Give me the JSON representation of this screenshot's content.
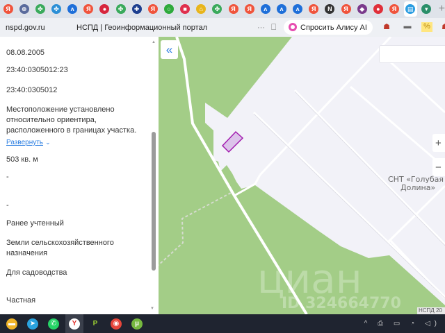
{
  "browser": {
    "tabs": [
      {
        "icon": "yandex-icon",
        "color": "#f0543c",
        "glyph": "Я"
      },
      {
        "icon": "emblem-icon",
        "color": "#5a6b9c",
        "glyph": "⊕"
      },
      {
        "icon": "gosuslugi-icon",
        "color": "#3aaa5c",
        "glyph": "✤"
      },
      {
        "icon": "gosuslugi-icon",
        "color": "#2b8fd6",
        "glyph": "✤"
      },
      {
        "icon": "avito-icon",
        "color": "#1e6fd9",
        "glyph": "ʌ"
      },
      {
        "icon": "yandex-icon",
        "color": "#f0543c",
        "glyph": "Я"
      },
      {
        "icon": "flag-icon",
        "color": "#d7263d",
        "glyph": "●"
      },
      {
        "icon": "gosuslugi-icon",
        "color": "#3aaa5c",
        "glyph": "✤"
      },
      {
        "icon": "hospital-icon",
        "color": "#1d3f8f",
        "glyph": "✚"
      },
      {
        "icon": "yandex-icon",
        "color": "#f0543c",
        "glyph": "Я"
      },
      {
        "icon": "circle-icon",
        "color": "#2eaa3c",
        "glyph": "○"
      },
      {
        "icon": "chat-icon",
        "color": "#e0304e",
        "glyph": "■"
      },
      {
        "icon": "home-icon",
        "color": "#e8b51c",
        "glyph": "⌂"
      },
      {
        "icon": "gosuslugi-icon",
        "color": "#3aaa5c",
        "glyph": "✤"
      },
      {
        "icon": "yandex-icon",
        "color": "#f0543c",
        "glyph": "Я"
      },
      {
        "icon": "yandex-icon",
        "color": "#f0543c",
        "glyph": "Я"
      },
      {
        "icon": "avito-icon",
        "color": "#1e6fd9",
        "glyph": "ʌ"
      },
      {
        "icon": "avito-icon",
        "color": "#1e6fd9",
        "glyph": "ʌ"
      },
      {
        "icon": "avito-icon",
        "color": "#1e6fd9",
        "glyph": "ʌ"
      },
      {
        "icon": "yandex-icon",
        "color": "#f0543c",
        "glyph": "Я"
      },
      {
        "icon": "notion-icon",
        "color": "#333333",
        "glyph": "N"
      },
      {
        "icon": "yandex-icon",
        "color": "#f0543c",
        "glyph": "Я"
      },
      {
        "icon": "shield-icon",
        "color": "#7a3a8c",
        "glyph": "◆"
      },
      {
        "icon": "map-pin-icon",
        "color": "#e0303a",
        "glyph": "●"
      },
      {
        "icon": "yandex-icon",
        "color": "#f0543c",
        "glyph": "Я"
      },
      {
        "icon": "nspd-icon",
        "color": "#2a9de1",
        "glyph": "▤",
        "active": true
      },
      {
        "icon": "map-icon",
        "color": "#2a8f6a",
        "glyph": "▾"
      }
    ],
    "url": "nspd.gov.ru",
    "page_title": "НСПД | Геоинформационный портал",
    "more_glyph": "···",
    "alice_label": "Спросить Алису AI",
    "ext_percent": "%"
  },
  "panel": {
    "fields": [
      "08.08.2005",
      "23:40:0305012:23",
      "23:40:0305012",
      "Местоположение установлено относительно ориентира, расположенного в границах участка.",
      "503 кв. м",
      "-",
      "-",
      "Ранее учтенный",
      "Земли сельскохозяйственного назначения",
      "Для садоводства",
      "Частная"
    ],
    "expand_label": "Развернуть"
  },
  "map": {
    "collapse_glyph": "«",
    "zoom_in": "+",
    "zoom_out": "−",
    "label_line1": "СНТ «Голубая",
    "label_line2": "Долина»",
    "watermark": "циан",
    "watermark_id": "ID 324664770",
    "attribution": "НСПД 20",
    "colors": {
      "forest": "#a3cd87",
      "land": "#f2f2f8",
      "parcel": "#a21caf",
      "road": "#ffffff"
    }
  },
  "taskbar": {
    "apps": [
      {
        "icon": "file-explorer-icon",
        "color": "#f0b429",
        "glyph": "▬"
      },
      {
        "icon": "telegram-icon",
        "color": "#2aa3de",
        "glyph": "➤"
      },
      {
        "icon": "whatsapp-icon",
        "color": "#25d366",
        "glyph": "✆"
      },
      {
        "icon": "yandex-browser-icon",
        "color": "#ffffff",
        "glyph": "Y",
        "active": true
      },
      {
        "icon": "p-app-icon",
        "color": "#1f2430",
        "glyph": "P"
      },
      {
        "icon": "chrome-icon",
        "color": "#e5453a",
        "glyph": "◉"
      },
      {
        "icon": "utorrent-icon",
        "color": "#76b83f",
        "glyph": "µ"
      }
    ],
    "tray": "^ ⎙ ▭ ◔ ◁)"
  }
}
